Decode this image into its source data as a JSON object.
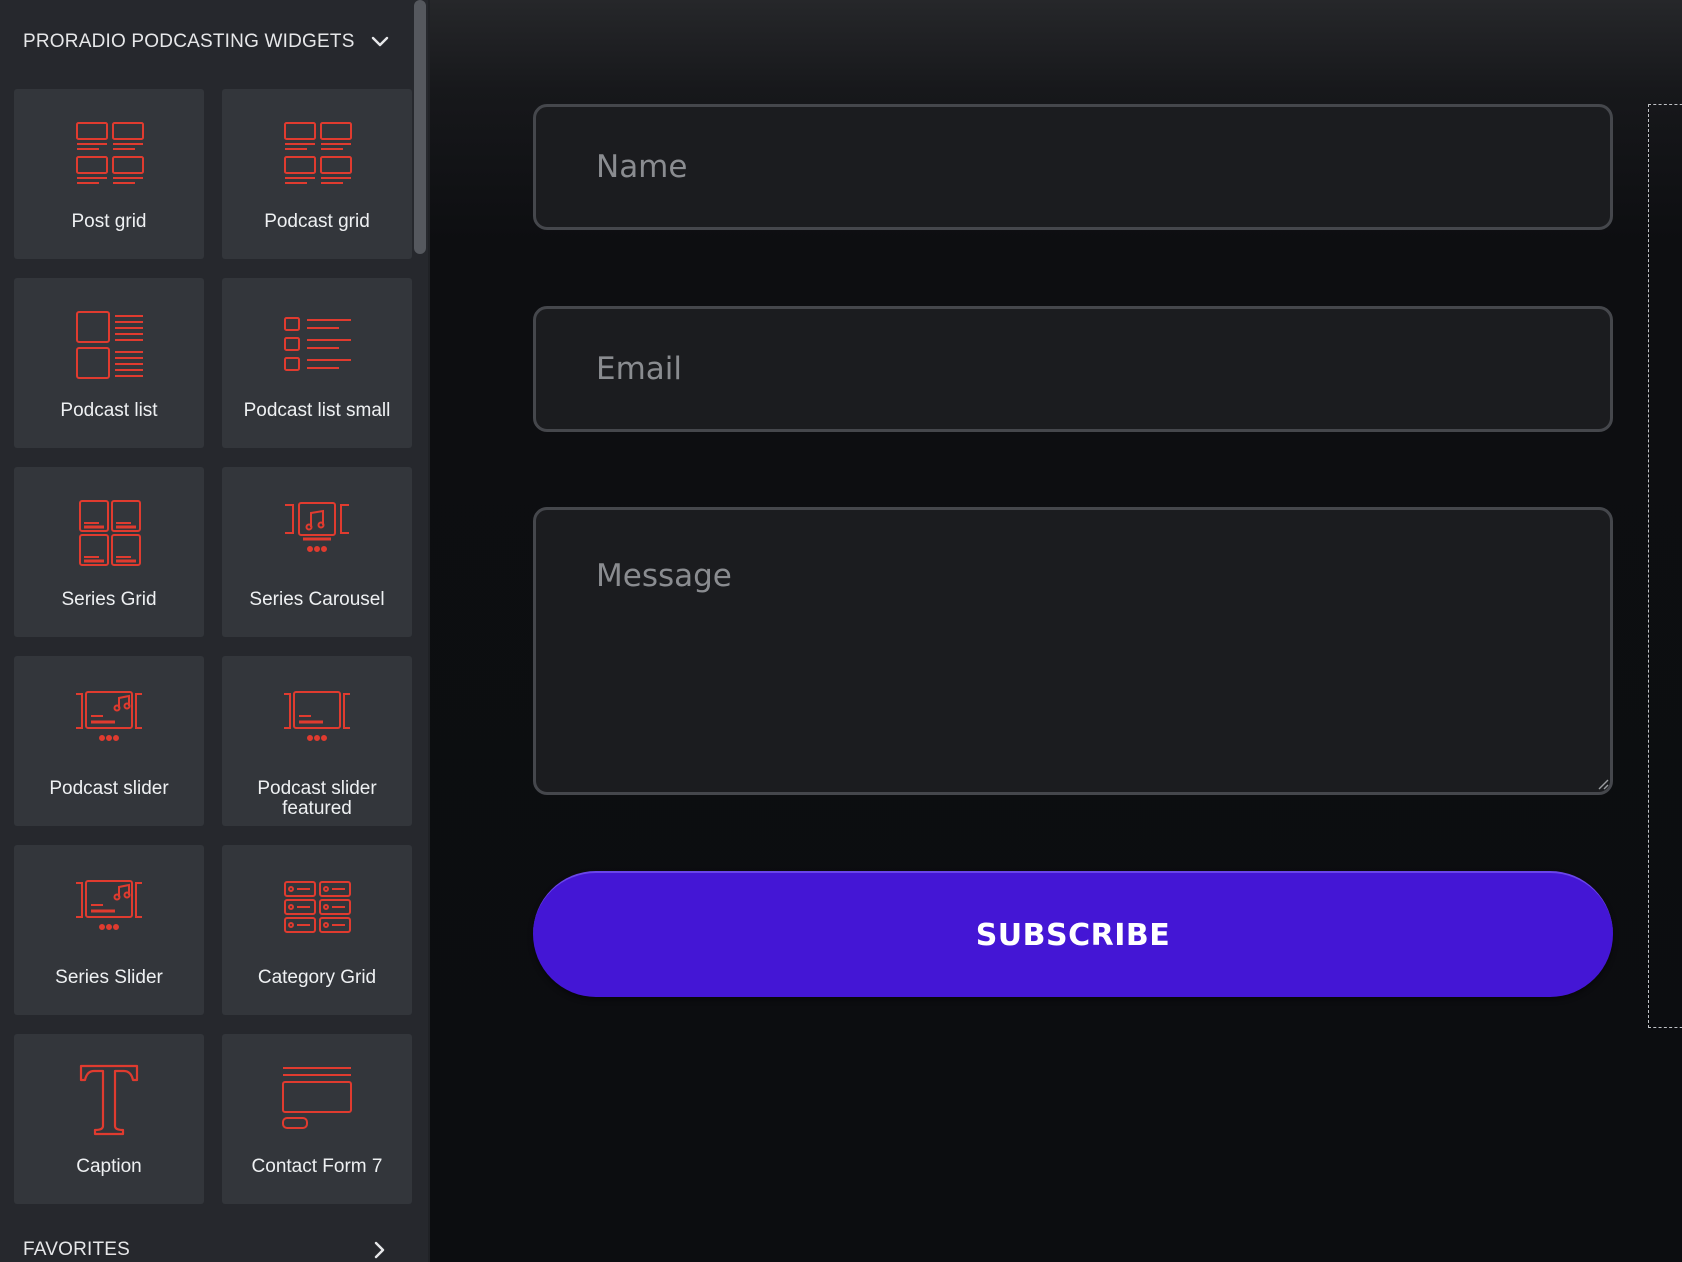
{
  "sidebar": {
    "section_title": "PRORADIO PODCASTING WIDGETS",
    "favorites_title": "FAVORITES",
    "widgets": [
      {
        "label": "Post grid",
        "icon": "post-grid-icon"
      },
      {
        "label": "Podcast grid",
        "icon": "podcast-grid-icon"
      },
      {
        "label": "Podcast list",
        "icon": "podcast-list-icon"
      },
      {
        "label": "Podcast list small",
        "icon": "podcast-list-small-icon"
      },
      {
        "label": "Series Grid",
        "icon": "series-grid-icon"
      },
      {
        "label": "Series Carousel",
        "icon": "series-carousel-icon"
      },
      {
        "label": "Podcast slider",
        "icon": "podcast-slider-icon"
      },
      {
        "label": "Podcast slider featured",
        "icon": "podcast-slider-featured-icon"
      },
      {
        "label": "Series Slider",
        "icon": "series-slider-icon"
      },
      {
        "label": "Category Grid",
        "icon": "category-grid-icon"
      },
      {
        "label": "Caption",
        "icon": "caption-icon"
      },
      {
        "label": "Contact Form 7",
        "icon": "contact-form-icon"
      }
    ]
  },
  "form": {
    "name_placeholder": "Name",
    "email_placeholder": "Email",
    "message_placeholder": "Message",
    "submit_label": "SUBSCRIBE"
  },
  "colors": {
    "icon_red": "#e03b2f",
    "button_purple": "#4416d5",
    "sidebar_bg": "#26282d",
    "tile_bg": "#33363b"
  }
}
